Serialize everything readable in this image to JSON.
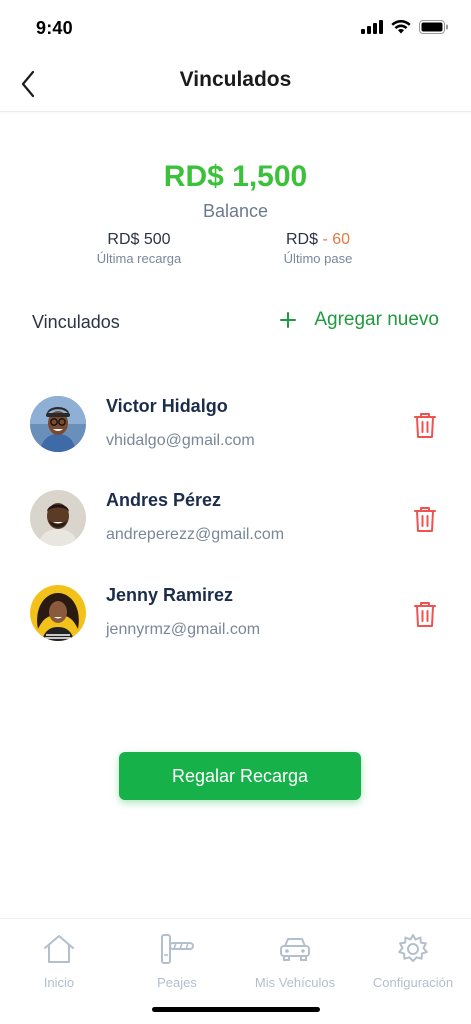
{
  "status_bar": {
    "time": "9:40"
  },
  "header": {
    "title": "Vinculados",
    "back_icon": "chevron-left-icon"
  },
  "balance": {
    "amount": "RD$ 1,500",
    "label": "Balance",
    "last_recharge": {
      "value": "RD$ 500",
      "label": "Última recarga"
    },
    "last_toll": {
      "currency": "RD$",
      "value": "- 60",
      "label": "Último pase"
    }
  },
  "linked": {
    "title": "Vinculados",
    "add_label": "Agregar nuevo",
    "add_icon": "plus-icon",
    "contacts": [
      {
        "name": "Victor Hidalgo",
        "email": "vhidalgo@gmail.com"
      },
      {
        "name": "Andres Pérez",
        "email": "andreperezz@gmail.com"
      },
      {
        "name": "Jenny Ramirez",
        "email": "jennyrmz@gmail.com"
      }
    ]
  },
  "action": {
    "label": "Regalar Recarga"
  },
  "tabs": [
    {
      "label": "Inicio",
      "icon": "home-icon"
    },
    {
      "label": "Peajes",
      "icon": "toll-barrier-icon"
    },
    {
      "label": "Mis Vehículos",
      "icon": "car-icon"
    },
    {
      "label": "Configuración",
      "icon": "gear-icon"
    }
  ],
  "colors": {
    "accent": "#3cc13b",
    "button": "#17b14a",
    "delete": "#ef5350",
    "muted": "#b3bfcd",
    "negative": "#e07a3f"
  }
}
